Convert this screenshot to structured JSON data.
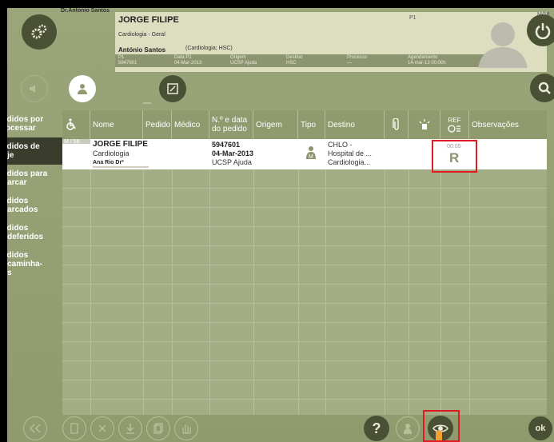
{
  "header": {
    "doctor_name": "Dr.Antonio Santos",
    "patient_name": "JORGE FILIPE",
    "specialty": "Cardiologia - Geral",
    "secondary_name": "António Santos",
    "secondary_detail": "(Cardiologia; HSC)",
    "tag_p1": "P1",
    "age_tag": "M/58",
    "info_cells": [
      {
        "label": "P1",
        "value": "5947601"
      },
      {
        "label": "Data P1",
        "value": "04-Mar-2013"
      },
      {
        "label": "Origem",
        "value": "UCSP Ajuda"
      },
      {
        "label": "Destino",
        "value": "HSC"
      },
      {
        "label": "Processo",
        "value": "—"
      },
      {
        "label": "Agendamento",
        "value": "14-mar-13 00:00h"
      }
    ]
  },
  "sidebar": {
    "items": [
      {
        "label": "edidos por\nrocessar"
      },
      {
        "label": "edidos de\noje"
      },
      {
        "label": "edidos para\nnarcar"
      },
      {
        "label": "edidos\nnarcados"
      },
      {
        "label": "edidos\nndeferidos"
      },
      {
        "label": "edidos\nncaminha-\nos"
      }
    ]
  },
  "table": {
    "headers": [
      "Nome",
      "Pedido",
      "Médico",
      "N.º e data\ndo pedido",
      "Origem",
      "Tipo",
      "Destino",
      "REF",
      "Observações"
    ],
    "row": {
      "age_tag": "M / 58",
      "name": "JORGE FILIPE",
      "specialty": "Cardiologia",
      "doctor": "Ana Rio Drª",
      "number": "5947601",
      "date": "04-Mar-2013",
      "origin": "UCSP Ajuda",
      "dest_line1": "CHLO -",
      "dest_line2": "Hospital de ...",
      "dest_line3": "Cardiologia...",
      "ref_time": "00:05",
      "ref_code": "R"
    }
  },
  "footer": {
    "ok_label": "ok"
  },
  "colors": {
    "background": "#8f9b6e",
    "card": "#ddddc0",
    "active_sidebar": "#3a3d2c",
    "highlight": "#e01b22"
  }
}
